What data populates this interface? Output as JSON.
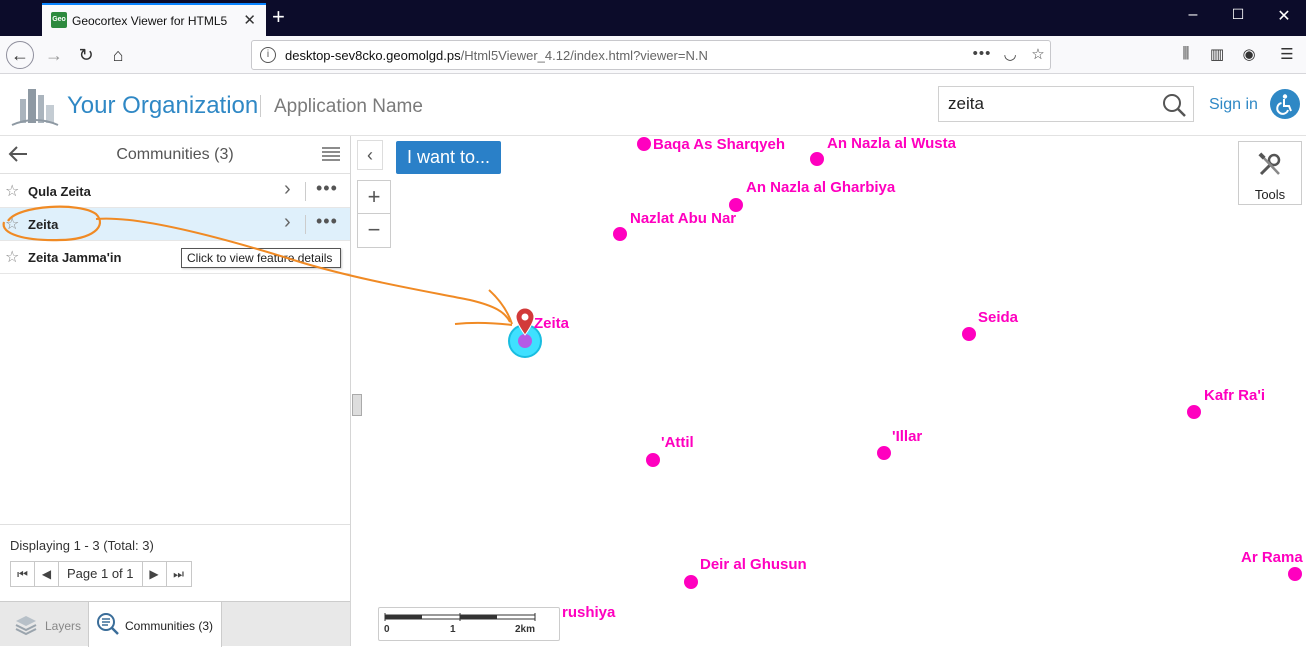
{
  "browser": {
    "tab_title": "Geocortex Viewer for HTML5",
    "favicon_text": "Geo",
    "url_host": "desktop-sev8cko.geomolgd.ps",
    "url_path": "/Html5Viewer_4.12/index.html?viewer=N.N"
  },
  "header": {
    "org_name": "Your Organization",
    "app_name": "Application Name",
    "search_value": "zeita",
    "sign_in": "Sign in",
    "accent": "#2f88c5"
  },
  "panel": {
    "title": "Communities (3)",
    "items": [
      {
        "label": "Qula Zeita"
      },
      {
        "label": "Zeita"
      },
      {
        "label": "Zeita Jamma'in"
      }
    ],
    "tooltip": "Click to view feature details",
    "display_text": "Displaying 1 - 3 (Total: 3)",
    "page_label": "Page 1 of 1",
    "tabs": {
      "layers": "Layers",
      "communities": "Communities (3)"
    }
  },
  "map": {
    "i_want_to": "I want to...",
    "tools": "Tools",
    "scale_ticks": [
      "0",
      "1",
      "2km"
    ],
    "selected_place": "Zeita",
    "place_color": "#ff00bf",
    "places": [
      {
        "name": "Baqa As Sharqyeh"
      },
      {
        "name": "An Nazla al Wusta"
      },
      {
        "name": "An Nazla al Gharbiya"
      },
      {
        "name": "Nazlat Abu Nar"
      },
      {
        "name": "Seida"
      },
      {
        "name": "Kafr Ra'i"
      },
      {
        "name": "'Attil"
      },
      {
        "name": "'Illar"
      },
      {
        "name": "Deir al Ghusun"
      },
      {
        "name": "Ar Rama"
      },
      {
        "name": "rushiya"
      }
    ]
  }
}
